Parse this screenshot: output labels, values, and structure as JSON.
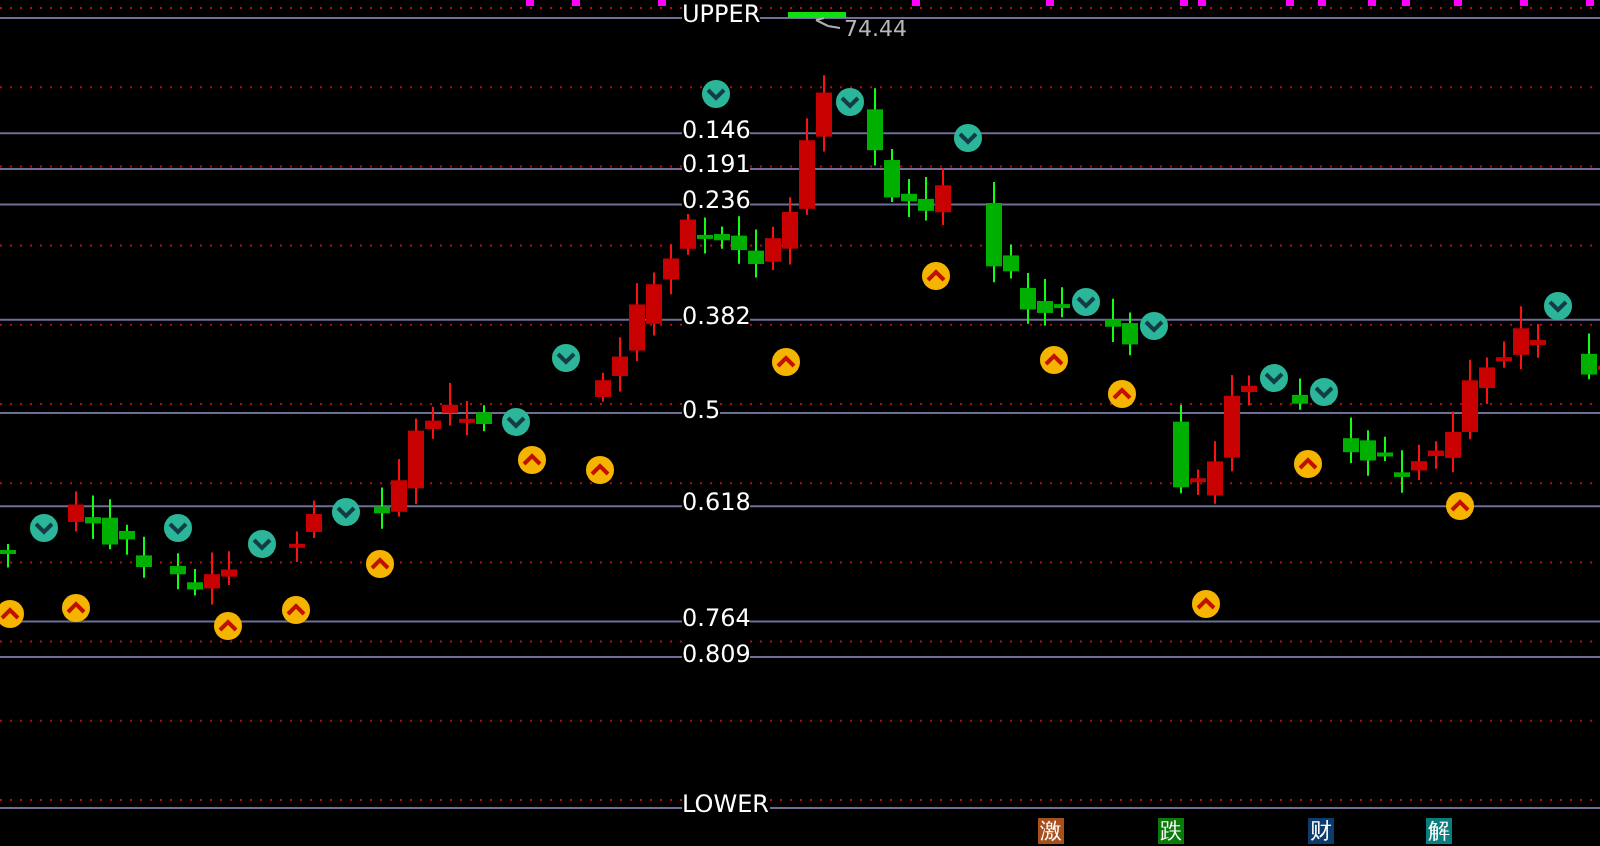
{
  "chart": {
    "levels": [
      {
        "label": "UPPER"
      },
      {
        "label": "0.146"
      },
      {
        "label": "0.191"
      },
      {
        "label": "0.236"
      },
      {
        "label": "0.382"
      },
      {
        "label": "0.5"
      },
      {
        "label": "0.618"
      },
      {
        "label": "0.764"
      },
      {
        "label": "0.809"
      },
      {
        "label": "LOWER"
      }
    ],
    "peak_label": "74.44",
    "tags": [
      {
        "text": "激",
        "color": "#a8501c"
      },
      {
        "text": "跌",
        "color": "#0a7a0a"
      },
      {
        "text": "财",
        "color": "#0c3c6c"
      },
      {
        "text": "解",
        "color": "#0a7e7e"
      }
    ]
  }
}
